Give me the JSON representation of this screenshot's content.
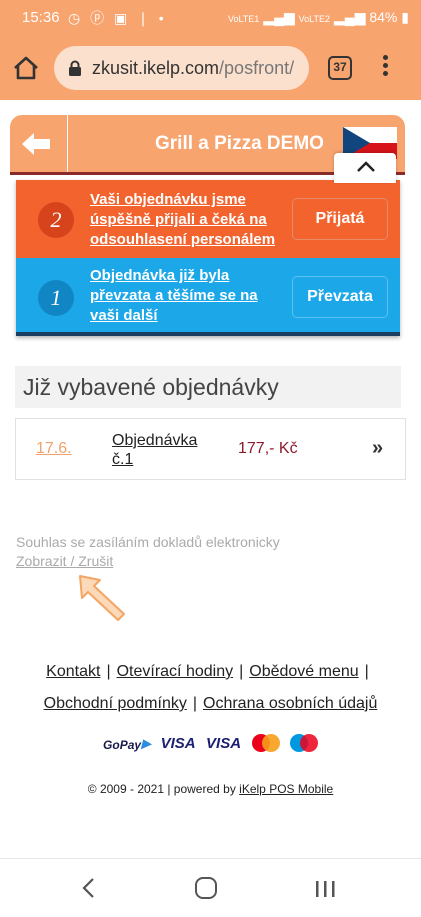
{
  "status_bar": {
    "time": "15:36",
    "left_icons": [
      "whatsapp-icon",
      "pinterest-icon",
      "gallery-icon",
      "thermometer-icon",
      "dot-icon"
    ],
    "network_label_1": "VoLTE1",
    "network_label_2": "VoLTE2",
    "battery": "84%"
  },
  "browser": {
    "url_domain": "zkusit.ikelp.com",
    "url_path": "/posfront/",
    "tab_count": "37"
  },
  "header": {
    "title": "Grill a Pizza DEMO"
  },
  "notifications": [
    {
      "number": "2",
      "text": "Vaši objednávku jsme úspěšně přijali a čeká na odsouhlasení personálem",
      "button": "Přijatá",
      "color": "#f2632e"
    },
    {
      "number": "1",
      "text": "Objednávka již byla převzata a těšíme se na vaši další",
      "button": "Převzata",
      "color": "#1ca7e8"
    }
  ],
  "orders": {
    "section_title": "Již vybavené objednávky",
    "rows": [
      {
        "date": "17.6.",
        "name": "Objednávka č.1",
        "price": "177,- Kč",
        "more": "»"
      }
    ]
  },
  "consent": {
    "label": "Souhlas se zasíláním dokladů elektronicky",
    "link": "Zobrazit / Zrušit"
  },
  "footer": {
    "links": [
      "Kontakt",
      "Otevírací hodiny",
      "Obědové menu",
      "Obchodní podmínky",
      "Ochrana osobních údajů"
    ],
    "separator": "|",
    "payments": [
      "GoPay",
      "VISA",
      "VISA",
      "mastercard",
      "maestro"
    ],
    "copyright_prefix": "© 2009 - 2021 | powered by ",
    "copyright_link": "iKelp POS Mobile"
  },
  "colors": {
    "accent": "#f7a46f",
    "header_border": "#8a2b2b",
    "notif_orange": "#f2632e",
    "notif_blue": "#1ca7e8",
    "price": "#8b1a2a"
  }
}
